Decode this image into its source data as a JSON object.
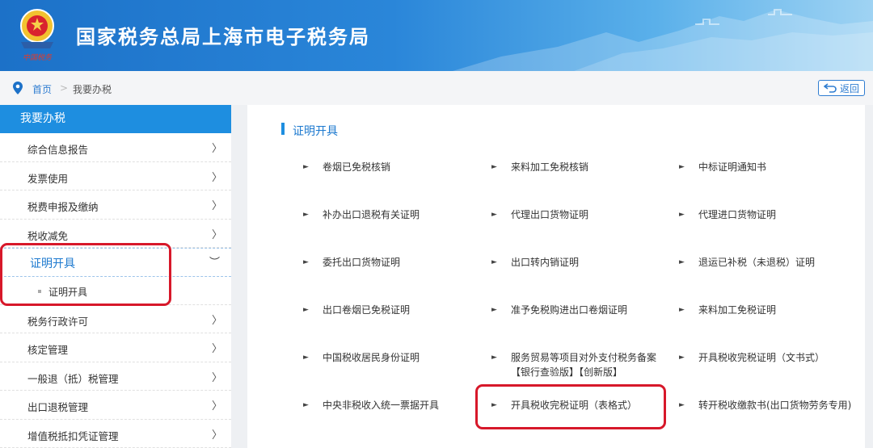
{
  "header": {
    "title": "国家税务总局上海市电子税务局",
    "emblem_caption": "中国税务"
  },
  "breadcrumb": {
    "home": "首页",
    "separator": ">",
    "current": "我要办税"
  },
  "back_button": "返回",
  "sidebar": {
    "heading": "我要办税",
    "items": [
      {
        "label": "综合信息报告",
        "chevron": "〉"
      },
      {
        "label": "发票使用",
        "chevron": "〉"
      },
      {
        "label": "税费申报及缴纳",
        "chevron": "〉"
      },
      {
        "label": "税收减免",
        "chevron": "〉"
      },
      {
        "label": "证明开具",
        "chevron": "︶"
      },
      {
        "label": "税务行政许可",
        "chevron": "〉"
      },
      {
        "label": "核定管理",
        "chevron": "〉"
      },
      {
        "label": "一般退（抵）税管理",
        "chevron": "〉"
      },
      {
        "label": "出口退税管理",
        "chevron": "〉"
      },
      {
        "label": "增值税抵扣凭证管理",
        "chevron": "〉"
      }
    ],
    "sub_items": [
      {
        "label": "证明开具"
      }
    ]
  },
  "main": {
    "section_title": "证明开具",
    "services": [
      "卷烟已免税核销",
      "来料加工免税核销",
      "中标证明通知书",
      "补办出口退税有关证明",
      "代理出口货物证明",
      "代理进口货物证明",
      "委托出口货物证明",
      "出口转内销证明",
      "退运已补税（未退税）证明",
      "出口卷烟已免税证明",
      "准予免税购进出口卷烟证明",
      "来料加工免税证明",
      "中国税收居民身份证明",
      "服务贸易等项目对外支付税务备案",
      "开具税收完税证明（文书式）",
      "中央非税收入统一票据开具",
      "开具税收完税证明（表格式）",
      "转开税收缴款书(出口货物劳务专用)"
    ],
    "service_note": "【银行查验版】【创新版】"
  },
  "colors": {
    "accent": "#1e8ee0",
    "highlight": "#d7182a"
  }
}
